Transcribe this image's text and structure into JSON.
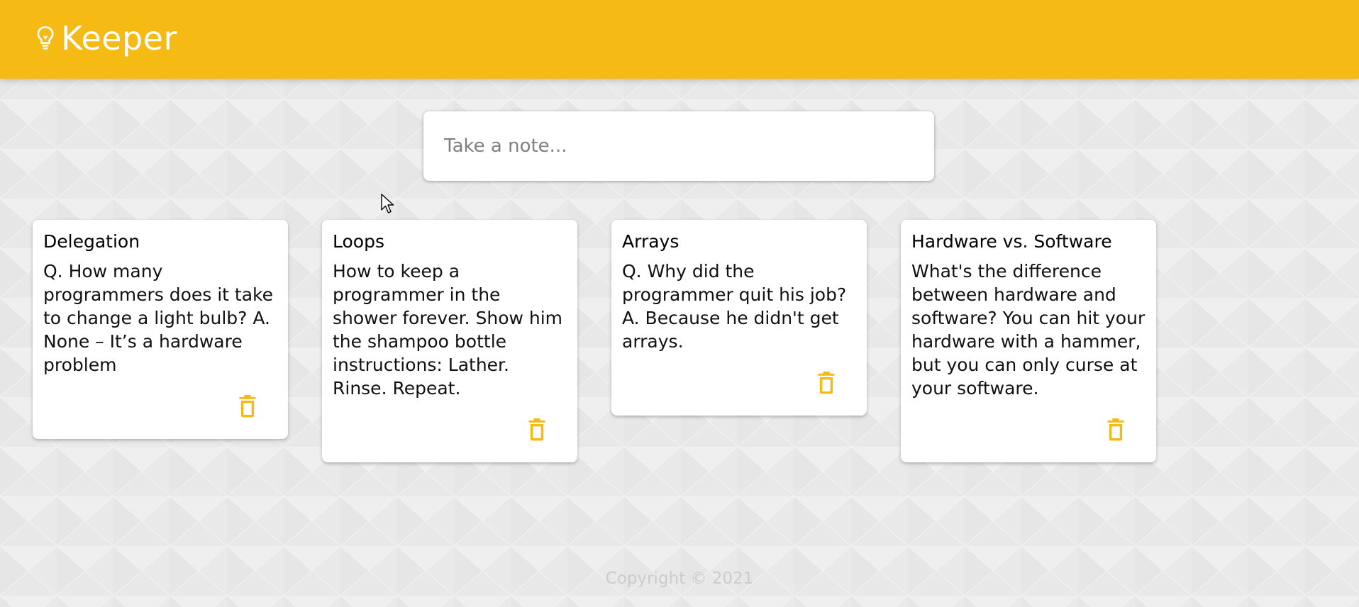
{
  "app": {
    "title": "Keeper",
    "logo_icon": "lightbulb-icon",
    "brand_color": "#f5ba13"
  },
  "create_note": {
    "placeholder": "Take a note...",
    "value": ""
  },
  "notes": [
    {
      "title": "Delegation",
      "content": "Q. How many programmers does it take to change a light bulb? A. None – It’s a hardware problem",
      "delete_icon": "delete-icon"
    },
    {
      "title": "Loops",
      "content": "How to keep a programmer in the shower forever. Show him the shampoo bottle instructions: Lather. Rinse. Repeat.",
      "delete_icon": "delete-icon"
    },
    {
      "title": "Arrays",
      "content": "Q. Why did the programmer quit his job? A. Because he didn't get arrays.",
      "delete_icon": "delete-icon"
    },
    {
      "title": "Hardware vs. Software",
      "content": "What's the difference between hardware and software? You can hit your hardware with a hammer, but you can only curse at your software.",
      "delete_icon": "delete-icon"
    }
  ],
  "footer": {
    "copyright": "Copyright © 2021"
  }
}
